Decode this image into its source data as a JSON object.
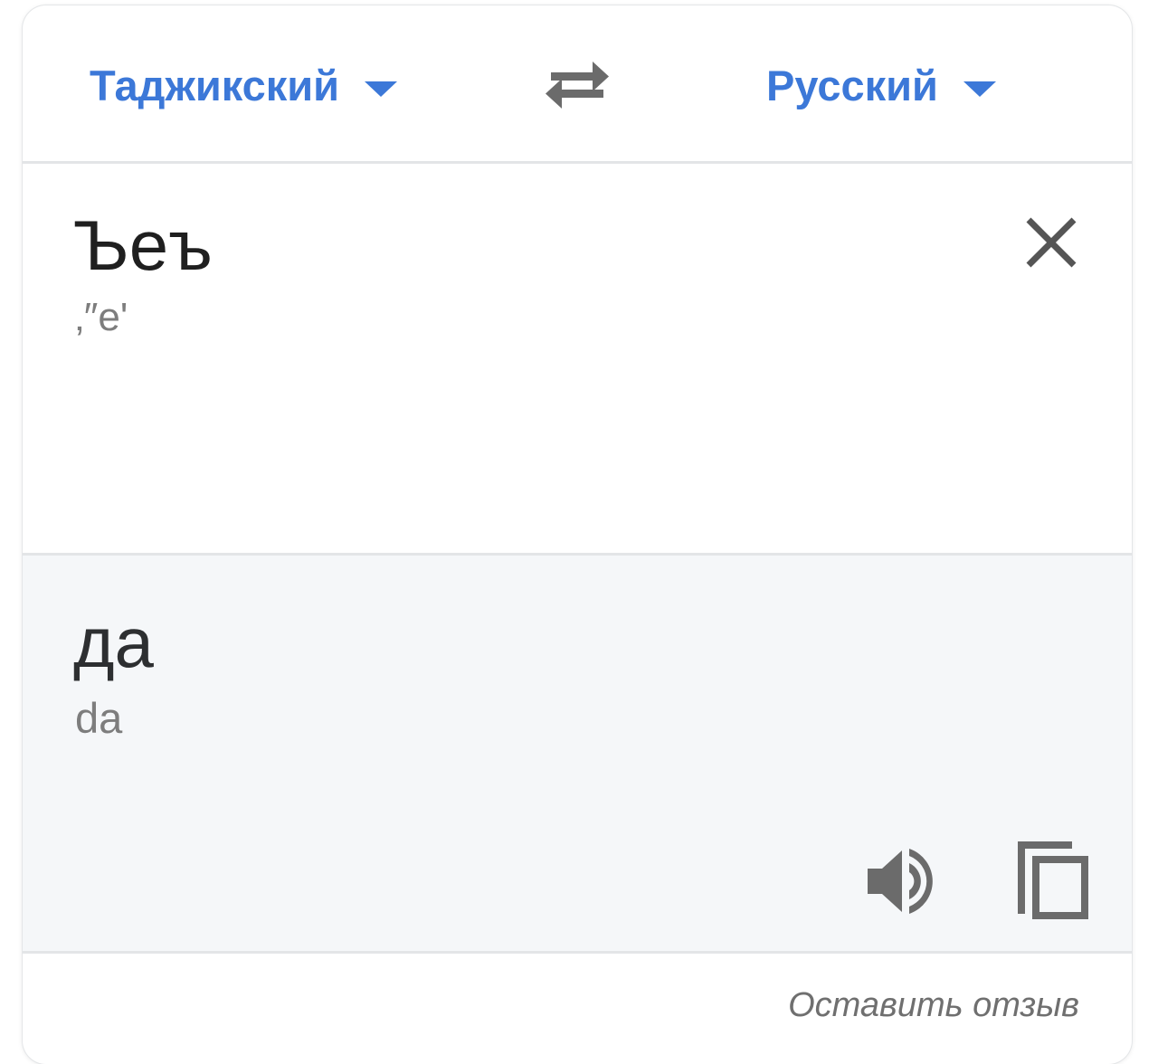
{
  "languages": {
    "source_label": "Таджикский",
    "target_label": "Русский"
  },
  "source": {
    "text": "Ъеъ",
    "transliteration": "‚″e'"
  },
  "target": {
    "text": "да",
    "transliteration": "da"
  },
  "footer": {
    "feedback_label": "Оставить отзыв"
  },
  "colors": {
    "accent": "#3c78d8",
    "icon": "#6b6b6b",
    "target_background": "#f5f7f9"
  },
  "icons": [
    "caret-down-icon",
    "swap-icon",
    "close-icon",
    "speaker-icon",
    "copy-icon"
  ]
}
